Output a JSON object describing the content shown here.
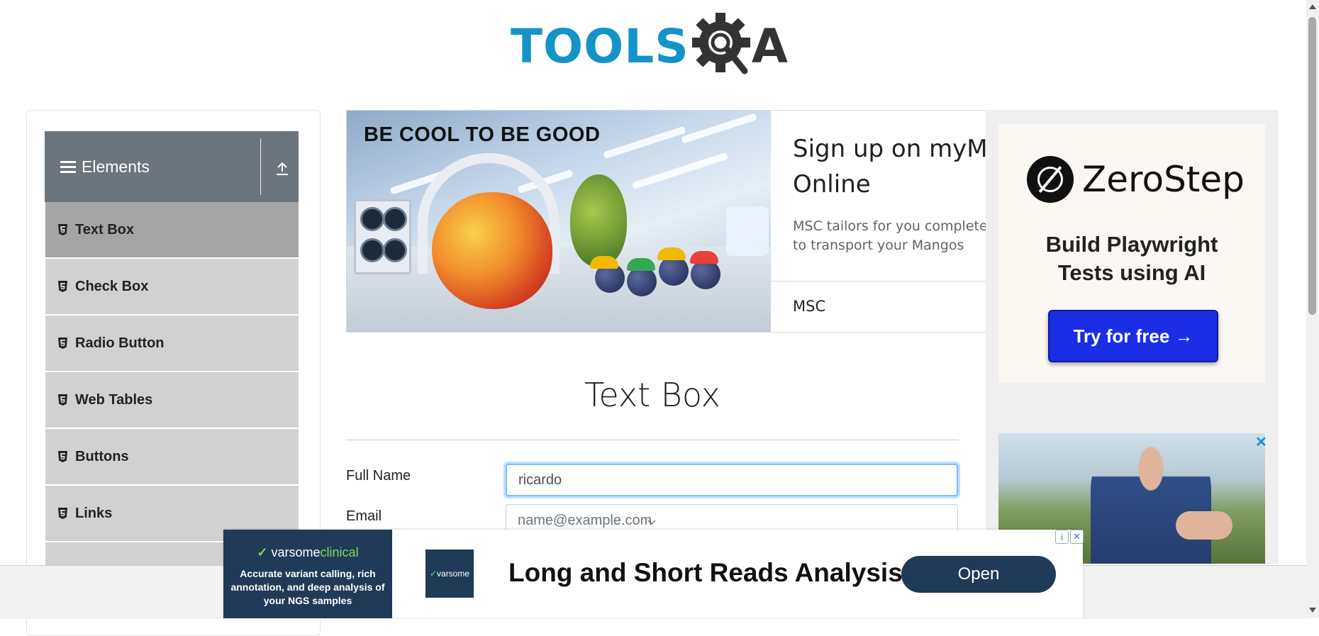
{
  "logo": {
    "text_tools": "TOOLS",
    "text_a": "A",
    "icon": "gear-magnifier-icon"
  },
  "sidebar": {
    "group_title": "Elements",
    "items": [
      {
        "label": "Text Box",
        "active": true
      },
      {
        "label": "Check Box",
        "active": false
      },
      {
        "label": "Radio Button",
        "active": false
      },
      {
        "label": "Web Tables",
        "active": false
      },
      {
        "label": "Buttons",
        "active": false
      },
      {
        "label": "Links",
        "active": false
      }
    ]
  },
  "banner_ad": {
    "art_title": "BE COOL TO BE GOOD",
    "headline": "Sign up on myMSC\nOnline",
    "headline_line1": "Sign up on myMSC",
    "headline_line2": "Online",
    "description_line1": "MSC tailors for you complete",
    "description_line2": "to transport your Mangos",
    "brand": "MSC"
  },
  "side_ad": {
    "brand": "ZeroStep",
    "tagline_line1": "Build Playwright",
    "tagline_line2": "Tests using AI",
    "cta": "Try for free →",
    "close_symbol": "✕"
  },
  "form": {
    "title": "Text Box",
    "full_name_label": "Full Name",
    "full_name_value": "ricardo",
    "email_label": "Email",
    "email_placeholder": "name@example.com"
  },
  "bottom_ad": {
    "brand_main": "varsome",
    "brand_sub": "clinical",
    "description": "Accurate variant calling, rich annotation, and deep analysis of your NGS samples",
    "thumb_text": "varsome",
    "headline": "Long and Short Reads Analysis",
    "cta": "Open"
  },
  "colors": {
    "brand_blue": "#1493c9",
    "sidebar_header": "#6c757d",
    "sidebar_item": "#d1d1d1",
    "sidebar_item_active": "#a5a5a5",
    "cta_blue": "#1a2ee5",
    "varsome_navy": "#1f3b57"
  }
}
